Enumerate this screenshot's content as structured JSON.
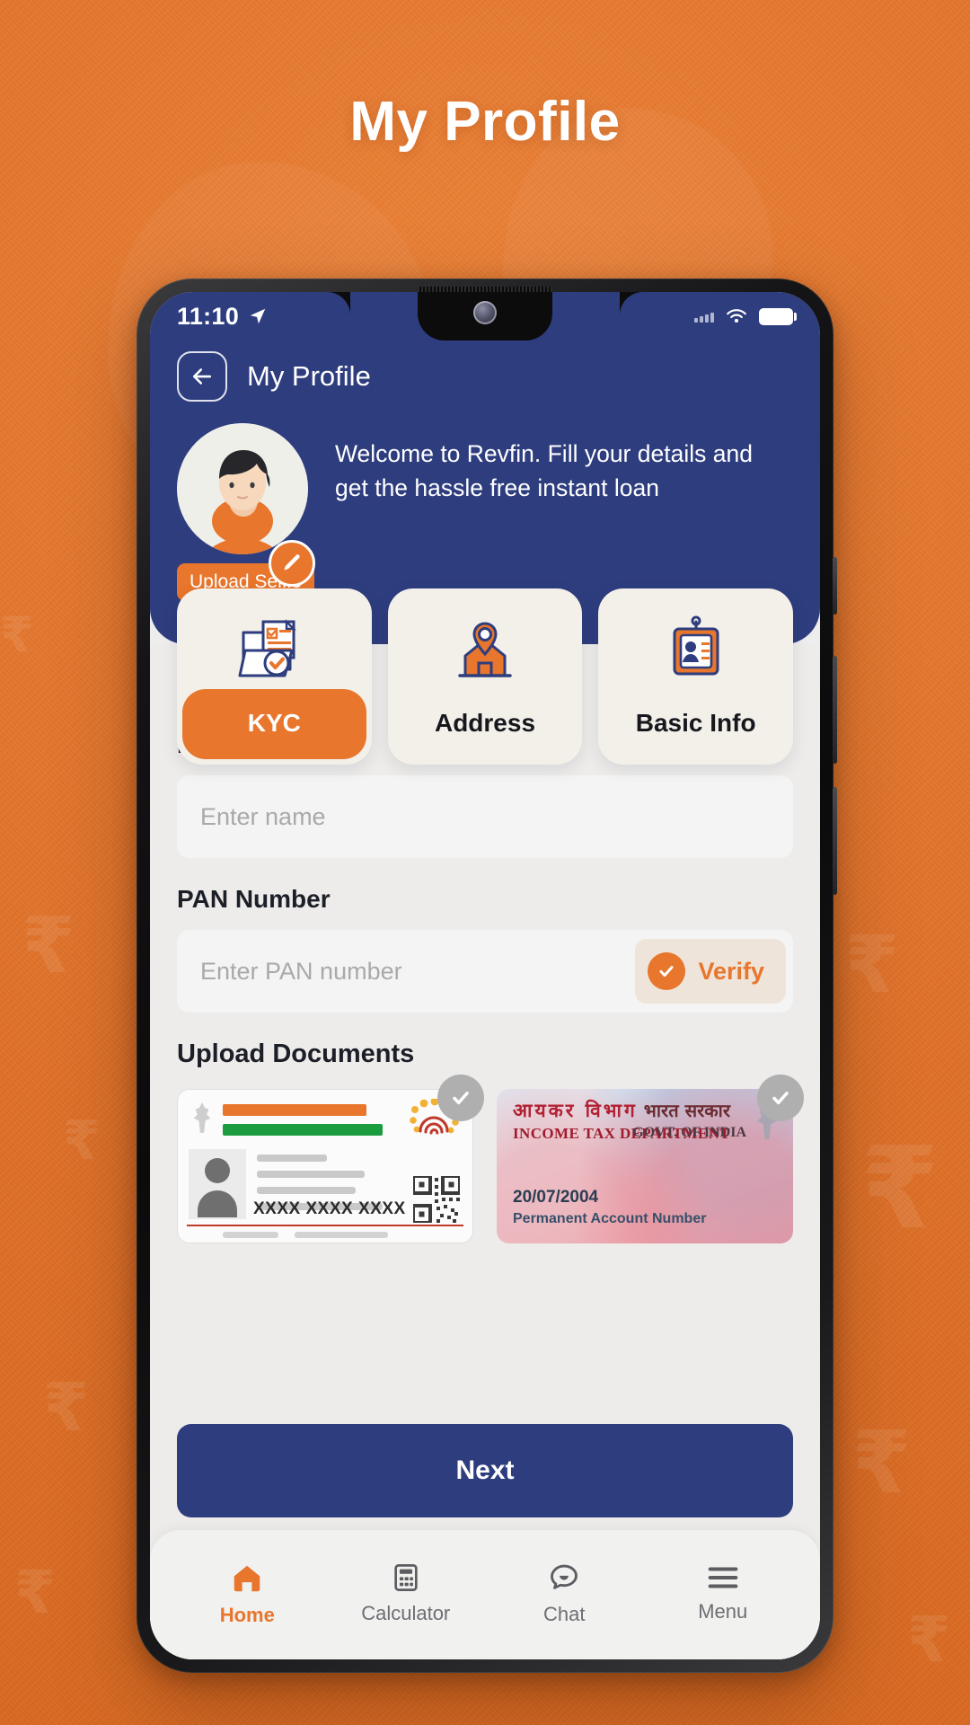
{
  "page": {
    "title": "My Profile",
    "background_color": "#E8762C",
    "accent_color": "#E8762C",
    "primary_color": "#2E3D7E"
  },
  "status_bar": {
    "time": "11:10",
    "location_icon": "location-arrow-icon",
    "signal_icon": "signal-bars-icon",
    "wifi_icon": "wifi-icon",
    "battery_icon": "battery-full-icon"
  },
  "app_bar": {
    "back_icon": "arrow-left-icon",
    "title": "My Profile"
  },
  "profile": {
    "avatar_icon": "user-avatar-image",
    "edit_icon": "pencil-edit-icon",
    "upload_selfie_label": "Upload Selfie",
    "welcome_text": "Welcome to Revfin. Fill your details and get the hassle free instant loan"
  },
  "tabs": [
    {
      "label": "KYC",
      "icon": "kyc-folder-document-icon",
      "active": true
    },
    {
      "label": "Address",
      "icon": "location-pin-house-icon",
      "active": false
    },
    {
      "label": "Basic Info",
      "icon": "id-card-person-icon",
      "active": false
    }
  ],
  "form": {
    "name": {
      "label": "Name",
      "placeholder": "Enter name",
      "value": ""
    },
    "pan": {
      "label": "PAN Number",
      "placeholder": "Enter PAN number",
      "value": "",
      "verify_label": "Verify",
      "verify_icon": "check-circle-icon"
    }
  },
  "documents": {
    "title": "Upload Documents",
    "items": [
      {
        "name": "aadhaar-card",
        "check_icon": "check-circle-icon",
        "masked_number": "XXXX XXXX XXXX",
        "qr_icon": "qr-code-icon",
        "emblem_icon": "india-emblem-icon",
        "aadhaar_logo_icon": "aadhaar-fingerprint-logo-icon"
      },
      {
        "name": "pan-card",
        "check_icon": "check-circle-icon",
        "hindi_title": "आयकर  विभाग",
        "english_title": "INCOME TAX DEPARTMENT",
        "govt_hindi": "भारत  सरकार",
        "govt_english": "GOVT. OF INDIA",
        "date": "20/07/2004",
        "subtitle": "Permanent Account Number",
        "emblem_icon": "india-emblem-icon"
      }
    ]
  },
  "next_button": {
    "label": "Next"
  },
  "bottom_nav": [
    {
      "label": "Home",
      "icon": "home-icon",
      "active": true
    },
    {
      "label": "Calculator",
      "icon": "calculator-icon",
      "active": false
    },
    {
      "label": "Chat",
      "icon": "chat-bubble-icon",
      "active": false
    },
    {
      "label": "Menu",
      "icon": "hamburger-menu-icon",
      "active": false
    }
  ]
}
